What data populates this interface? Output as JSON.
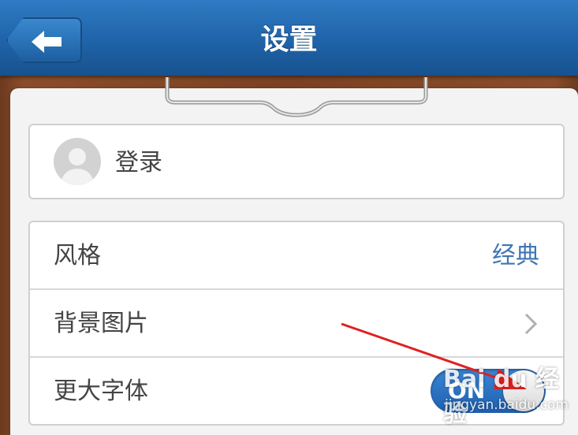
{
  "header": {
    "title": "设置",
    "back_icon": "arrow-left-icon"
  },
  "login": {
    "label": "登录",
    "avatar_icon": "user-avatar-icon"
  },
  "settings": {
    "style": {
      "label": "风格",
      "value": "经典"
    },
    "background": {
      "label": "背景图片",
      "icon": "chevron-right-icon"
    },
    "large_font": {
      "label": "更大字体",
      "toggle_text": "ON",
      "toggle_on": true
    }
  },
  "annotation": {
    "icon": "red-arrow-annotation"
  },
  "watermark": {
    "logo": "Bai du 经验",
    "url": "jingyan.baidu.com"
  },
  "colors": {
    "header": "#1f63a8",
    "accent": "#3f76b6",
    "toggle": "#2a73c4",
    "annotation": "#e02020"
  }
}
